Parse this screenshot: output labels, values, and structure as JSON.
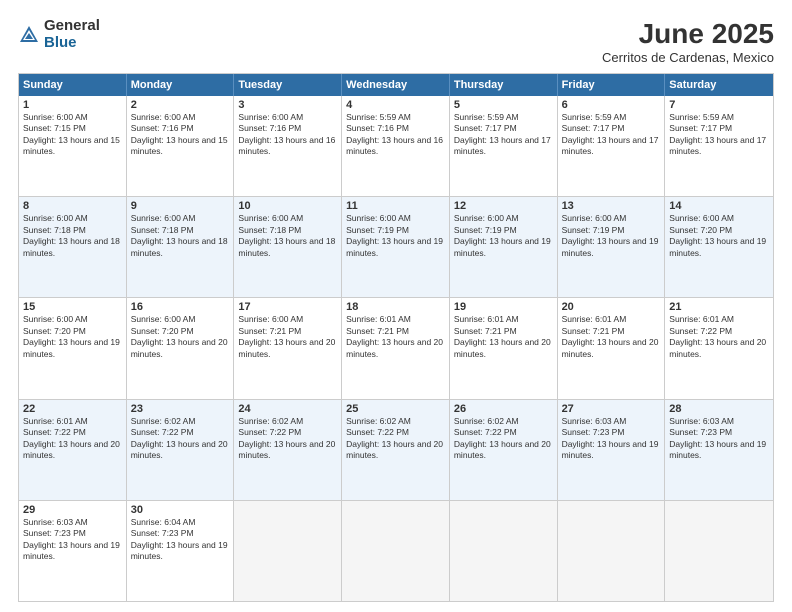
{
  "logo": {
    "general": "General",
    "blue": "Blue"
  },
  "title": "June 2025",
  "subtitle": "Cerritos de Cardenas, Mexico",
  "header_days": [
    "Sunday",
    "Monday",
    "Tuesday",
    "Wednesday",
    "Thursday",
    "Friday",
    "Saturday"
  ],
  "weeks": [
    [
      {
        "num": "1",
        "sunrise": "Sunrise: 6:00 AM",
        "sunset": "Sunset: 7:15 PM",
        "daylight": "Daylight: 13 hours and 15 minutes."
      },
      {
        "num": "2",
        "sunrise": "Sunrise: 6:00 AM",
        "sunset": "Sunset: 7:16 PM",
        "daylight": "Daylight: 13 hours and 15 minutes."
      },
      {
        "num": "3",
        "sunrise": "Sunrise: 6:00 AM",
        "sunset": "Sunset: 7:16 PM",
        "daylight": "Daylight: 13 hours and 16 minutes."
      },
      {
        "num": "4",
        "sunrise": "Sunrise: 5:59 AM",
        "sunset": "Sunset: 7:16 PM",
        "daylight": "Daylight: 13 hours and 16 minutes."
      },
      {
        "num": "5",
        "sunrise": "Sunrise: 5:59 AM",
        "sunset": "Sunset: 7:17 PM",
        "daylight": "Daylight: 13 hours and 17 minutes."
      },
      {
        "num": "6",
        "sunrise": "Sunrise: 5:59 AM",
        "sunset": "Sunset: 7:17 PM",
        "daylight": "Daylight: 13 hours and 17 minutes."
      },
      {
        "num": "7",
        "sunrise": "Sunrise: 5:59 AM",
        "sunset": "Sunset: 7:17 PM",
        "daylight": "Daylight: 13 hours and 17 minutes."
      }
    ],
    [
      {
        "num": "8",
        "sunrise": "Sunrise: 6:00 AM",
        "sunset": "Sunset: 7:18 PM",
        "daylight": "Daylight: 13 hours and 18 minutes."
      },
      {
        "num": "9",
        "sunrise": "Sunrise: 6:00 AM",
        "sunset": "Sunset: 7:18 PM",
        "daylight": "Daylight: 13 hours and 18 minutes."
      },
      {
        "num": "10",
        "sunrise": "Sunrise: 6:00 AM",
        "sunset": "Sunset: 7:18 PM",
        "daylight": "Daylight: 13 hours and 18 minutes."
      },
      {
        "num": "11",
        "sunrise": "Sunrise: 6:00 AM",
        "sunset": "Sunset: 7:19 PM",
        "daylight": "Daylight: 13 hours and 19 minutes."
      },
      {
        "num": "12",
        "sunrise": "Sunrise: 6:00 AM",
        "sunset": "Sunset: 7:19 PM",
        "daylight": "Daylight: 13 hours and 19 minutes."
      },
      {
        "num": "13",
        "sunrise": "Sunrise: 6:00 AM",
        "sunset": "Sunset: 7:19 PM",
        "daylight": "Daylight: 13 hours and 19 minutes."
      },
      {
        "num": "14",
        "sunrise": "Sunrise: 6:00 AM",
        "sunset": "Sunset: 7:20 PM",
        "daylight": "Daylight: 13 hours and 19 minutes."
      }
    ],
    [
      {
        "num": "15",
        "sunrise": "Sunrise: 6:00 AM",
        "sunset": "Sunset: 7:20 PM",
        "daylight": "Daylight: 13 hours and 19 minutes."
      },
      {
        "num": "16",
        "sunrise": "Sunrise: 6:00 AM",
        "sunset": "Sunset: 7:20 PM",
        "daylight": "Daylight: 13 hours and 20 minutes."
      },
      {
        "num": "17",
        "sunrise": "Sunrise: 6:00 AM",
        "sunset": "Sunset: 7:21 PM",
        "daylight": "Daylight: 13 hours and 20 minutes."
      },
      {
        "num": "18",
        "sunrise": "Sunrise: 6:01 AM",
        "sunset": "Sunset: 7:21 PM",
        "daylight": "Daylight: 13 hours and 20 minutes."
      },
      {
        "num": "19",
        "sunrise": "Sunrise: 6:01 AM",
        "sunset": "Sunset: 7:21 PM",
        "daylight": "Daylight: 13 hours and 20 minutes."
      },
      {
        "num": "20",
        "sunrise": "Sunrise: 6:01 AM",
        "sunset": "Sunset: 7:21 PM",
        "daylight": "Daylight: 13 hours and 20 minutes."
      },
      {
        "num": "21",
        "sunrise": "Sunrise: 6:01 AM",
        "sunset": "Sunset: 7:22 PM",
        "daylight": "Daylight: 13 hours and 20 minutes."
      }
    ],
    [
      {
        "num": "22",
        "sunrise": "Sunrise: 6:01 AM",
        "sunset": "Sunset: 7:22 PM",
        "daylight": "Daylight: 13 hours and 20 minutes."
      },
      {
        "num": "23",
        "sunrise": "Sunrise: 6:02 AM",
        "sunset": "Sunset: 7:22 PM",
        "daylight": "Daylight: 13 hours and 20 minutes."
      },
      {
        "num": "24",
        "sunrise": "Sunrise: 6:02 AM",
        "sunset": "Sunset: 7:22 PM",
        "daylight": "Daylight: 13 hours and 20 minutes."
      },
      {
        "num": "25",
        "sunrise": "Sunrise: 6:02 AM",
        "sunset": "Sunset: 7:22 PM",
        "daylight": "Daylight: 13 hours and 20 minutes."
      },
      {
        "num": "26",
        "sunrise": "Sunrise: 6:02 AM",
        "sunset": "Sunset: 7:22 PM",
        "daylight": "Daylight: 13 hours and 20 minutes."
      },
      {
        "num": "27",
        "sunrise": "Sunrise: 6:03 AM",
        "sunset": "Sunset: 7:23 PM",
        "daylight": "Daylight: 13 hours and 19 minutes."
      },
      {
        "num": "28",
        "sunrise": "Sunrise: 6:03 AM",
        "sunset": "Sunset: 7:23 PM",
        "daylight": "Daylight: 13 hours and 19 minutes."
      }
    ],
    [
      {
        "num": "29",
        "sunrise": "Sunrise: 6:03 AM",
        "sunset": "Sunset: 7:23 PM",
        "daylight": "Daylight: 13 hours and 19 minutes."
      },
      {
        "num": "30",
        "sunrise": "Sunrise: 6:04 AM",
        "sunset": "Sunset: 7:23 PM",
        "daylight": "Daylight: 13 hours and 19 minutes."
      },
      null,
      null,
      null,
      null,
      null
    ]
  ]
}
